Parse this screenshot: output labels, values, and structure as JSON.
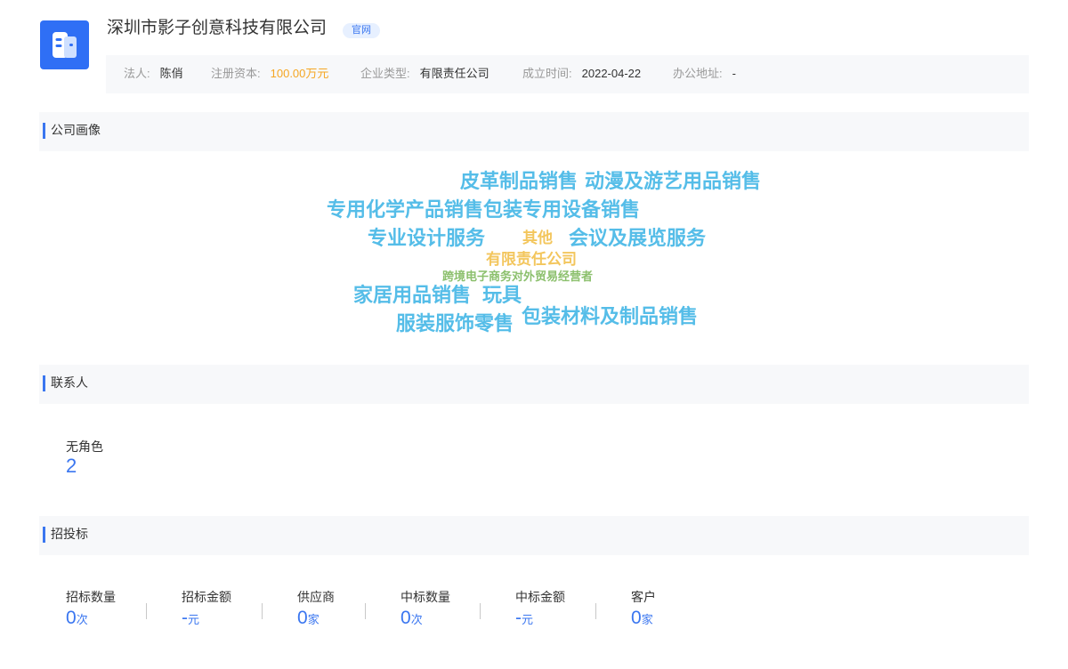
{
  "header": {
    "logo_icon": "building-icon",
    "company_name": "深圳市影子创意科技有限公司",
    "website_badge": "官网"
  },
  "info": {
    "legal_person_label": "法人:",
    "legal_person": "陈俏",
    "capital_label": "注册资本:",
    "capital": "100.00万元",
    "type_label": "企业类型:",
    "type": "有限责任公司",
    "founded_label": "成立时间:",
    "founded": "2022-04-22",
    "address_label": "办公地址:",
    "address": "-"
  },
  "sections": {
    "portrait": "公司画像",
    "contacts": "联系人",
    "bidding": "招投标"
  },
  "word_cloud": [
    "皮革制品销售",
    "动漫及游艺用品销售",
    "专用化学产品销售",
    "包装专用设备销售",
    "专业设计服务",
    "其他",
    "会议及展览服务",
    "有限责任公司",
    "跨境电子商务对外贸易经营者",
    "家居用品销售",
    "玩具",
    "服装服饰零售",
    "包装材料及制品销售"
  ],
  "contacts": {
    "role_label": "无角色",
    "role_count": "2"
  },
  "bidding_stats": [
    {
      "label": "招标数量",
      "value": "0",
      "unit": "次"
    },
    {
      "label": "招标金额",
      "value": "-",
      "unit": "元"
    },
    {
      "label": "供应商",
      "value": "0",
      "unit": "家"
    },
    {
      "label": "中标数量",
      "value": "0",
      "unit": "次"
    },
    {
      "label": "中标金额",
      "value": "-",
      "unit": "元"
    },
    {
      "label": "客户",
      "value": "0",
      "unit": "家"
    }
  ],
  "colors": {
    "accent": "#3a76f0",
    "logo_bg": "#2f6ff5",
    "capital": "#f5a623",
    "cloud_blue": "#55bde8",
    "cloud_yellow": "#f3c65d",
    "cloud_green": "#8cc06d"
  }
}
